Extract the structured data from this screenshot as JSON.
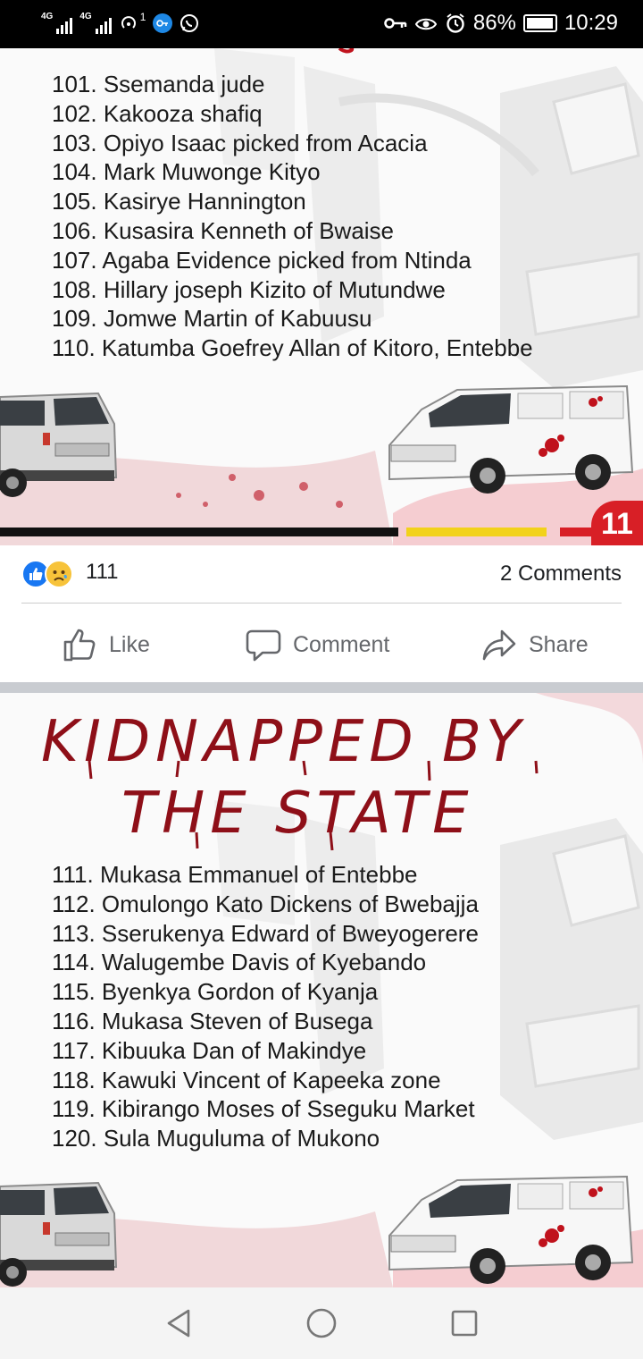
{
  "status_bar": {
    "net1": "4G",
    "net2": "4G",
    "sup": "1",
    "battery": "86%",
    "time": "10:29"
  },
  "post1": {
    "list": [
      "101. Ssemanda jude",
      "102. Kakooza shafiq",
      "103. Opiyo Isaac picked from Acacia",
      "104. Mark Muwonge Kityo",
      "105. Kasirye Hannington",
      "106. Kusasira Kenneth of Bwaise",
      "107. Agaba Evidence picked from Ntinda",
      "108. Hillary joseph Kizito of Mutundwe",
      "109. Jomwe Martin of Kabuusu",
      "110. Katumba Goefrey Allan of Kitoro, Entebbe"
    ],
    "page_number": "11"
  },
  "reactions": {
    "count": "111",
    "comments": "2 Comments"
  },
  "actions": {
    "like": "Like",
    "comment": "Comment",
    "share": "Share"
  },
  "post2": {
    "title_line1": "KIDNAPPED BY",
    "title_line2": "THE STATE",
    "list": [
      "111. Mukasa Emmanuel of Entebbe",
      "112. Omulongo Kato Dickens of Bwebajja",
      "113. Sserukenya Edward of Bweyogerere",
      "114. Walugembe Davis of Kyebando",
      "115. Byenkya Gordon of Kyanja",
      "116. Mukasa Steven of Busega",
      "117. Kibuuka Dan of Makindye",
      "118. Kawuki Vincent of Kapeeka zone",
      "119. Kibirango Moses of Sseguku Market",
      "120. Sula Muguluma of Mukono"
    ]
  },
  "colors": {
    "facebook_blue": "#1877f2",
    "blood_red": "#b1121c",
    "flag_black": "#111111",
    "flag_yellow": "#f2d21b",
    "flag_red": "#d81f26"
  }
}
